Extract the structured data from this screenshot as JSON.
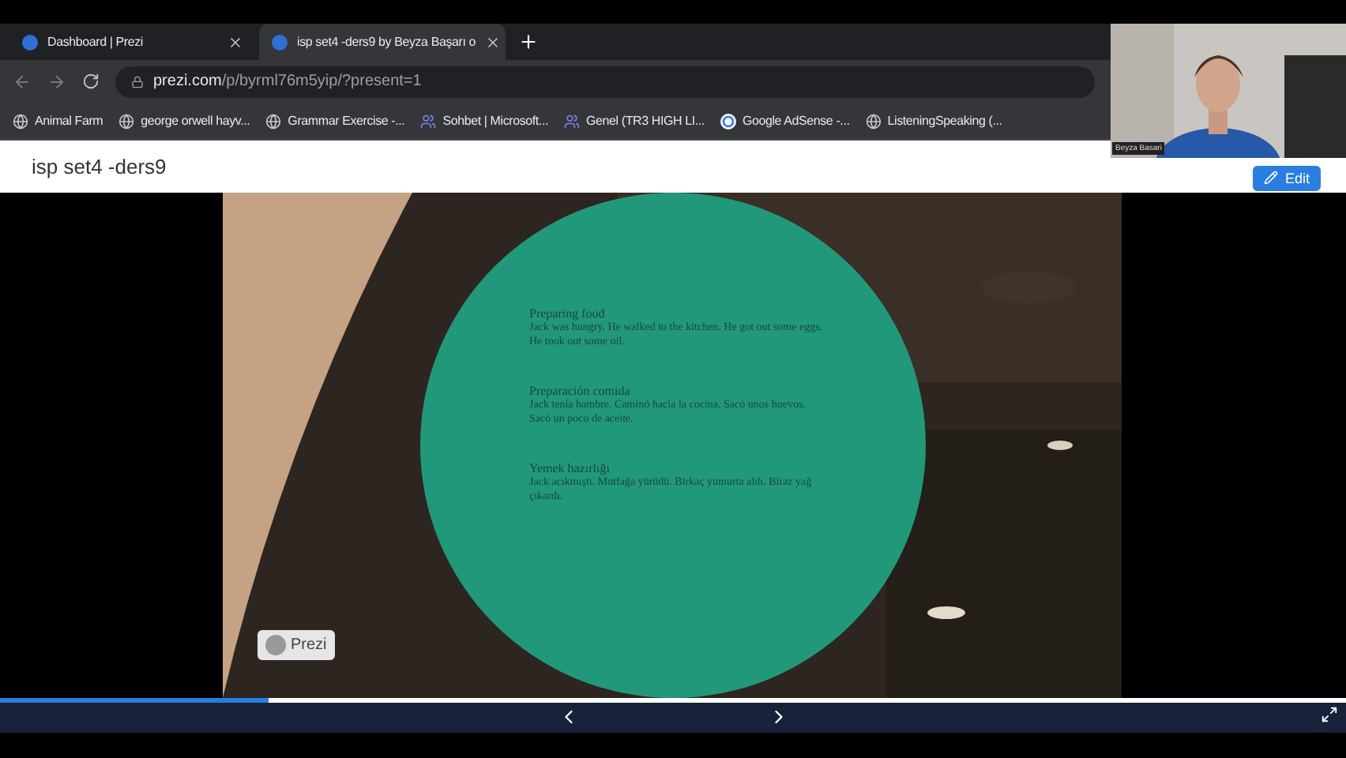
{
  "tabs": [
    {
      "title": "Dashboard | Prezi",
      "selected": false
    },
    {
      "title": "isp set4 -ders9 by Beyza Başarı o",
      "selected": true
    }
  ],
  "address": {
    "domain": "prezi.com",
    "path": "/p/byrml76m5yip/?present=1"
  },
  "bookmarks": [
    {
      "label": "Animal Farm",
      "kind": "globe"
    },
    {
      "label": "george orwell hayv...",
      "kind": "globe"
    },
    {
      "label": "Grammar Exercise -...",
      "kind": "globe"
    },
    {
      "label": "Sohbet | Microsoft...",
      "kind": "teams"
    },
    {
      "label": "Genel (TR3 HIGH LI...",
      "kind": "teams"
    },
    {
      "label": "Google AdSense -...",
      "kind": "google"
    },
    {
      "label": "ListeningSpeaking (...",
      "kind": "globe"
    }
  ],
  "presentation": {
    "title": "isp set4 -ders9",
    "edit_button": "Edit"
  },
  "slide": {
    "blocks": [
      {
        "heading": "Preparing food",
        "body": "Jack was hungry. He walked to the kitchen. He got out some eggs. He took out some oil."
      },
      {
        "heading": "Preparación comida",
        "body": "Jack tenía hambre. Caminó hacia la cocina. Sacó unos huevos. Sacó un poco de aceite."
      },
      {
        "heading": "Yemek hazırlığı",
        "body": "Jack acıkmıştı. Mutfağa yürüdü. Birkaç yumurta aldı. Biraz yağ çıkardı."
      }
    ],
    "badge": "Prezi"
  },
  "progress": {
    "level": 0.2
  },
  "webcam": {
    "name": "Beyza Basari"
  }
}
